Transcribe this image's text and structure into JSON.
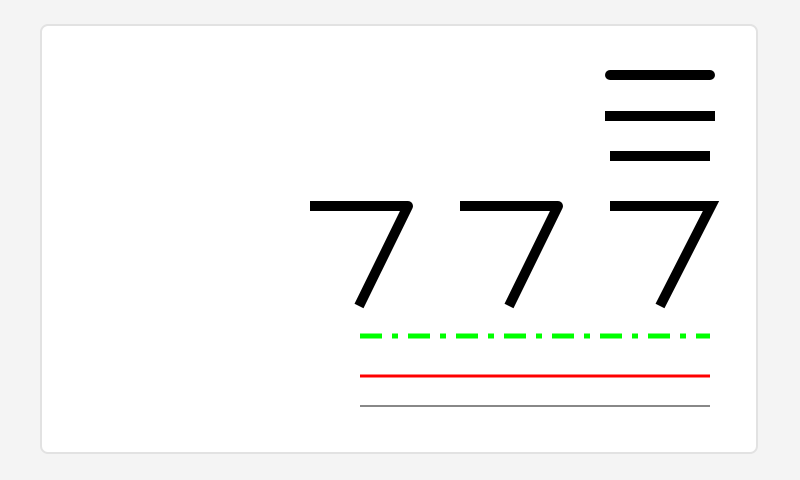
{
  "sequence": {
    "digits": [
      "7",
      "7",
      "7"
    ],
    "top_symbol": "☰"
  },
  "colors": {
    "stroke": "#000000",
    "dashed_line": "#00ff00",
    "solid_line": "#ff0000",
    "base_line": "#888888",
    "card_background": "#ffffff",
    "page_background": "#f4f4f4"
  }
}
